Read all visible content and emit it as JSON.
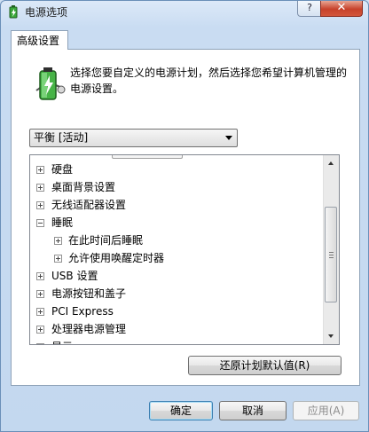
{
  "window": {
    "title": "电源选项",
    "help_label": "?",
    "close_label": "✕"
  },
  "tab": {
    "label": "高级设置"
  },
  "description": "选择您要自定义的电源计划，然后选择您希望计算机管理的电源设置。",
  "plan_select": {
    "value": "平衡 [活动]"
  },
  "tree": {
    "items": [
      {
        "label": "硬盘",
        "level": 0,
        "expanded": false
      },
      {
        "label": "桌面背景设置",
        "level": 0,
        "expanded": false
      },
      {
        "label": "无线适配器设置",
        "level": 0,
        "expanded": false
      },
      {
        "label": "睡眠",
        "level": 0,
        "expanded": true
      },
      {
        "label": "在此时间后睡眠",
        "level": 1,
        "expanded": false
      },
      {
        "label": "允许使用唤醒定时器",
        "level": 1,
        "expanded": false
      },
      {
        "label": "USB 设置",
        "level": 0,
        "expanded": false
      },
      {
        "label": "电源按钮和盖子",
        "level": 0,
        "expanded": false
      },
      {
        "label": "PCI Express",
        "level": 0,
        "expanded": false
      },
      {
        "label": "处理器电源管理",
        "level": 0,
        "expanded": false
      },
      {
        "label": "显示",
        "level": 0,
        "expanded": false
      }
    ]
  },
  "buttons": {
    "restore": "还原计划默认值(R)",
    "ok": "确定",
    "cancel": "取消",
    "apply": "应用(A)"
  },
  "colors": {
    "window_frame": "#c3d8ef",
    "close_red": "#c7422b",
    "battery_green": "#3aa83a"
  }
}
